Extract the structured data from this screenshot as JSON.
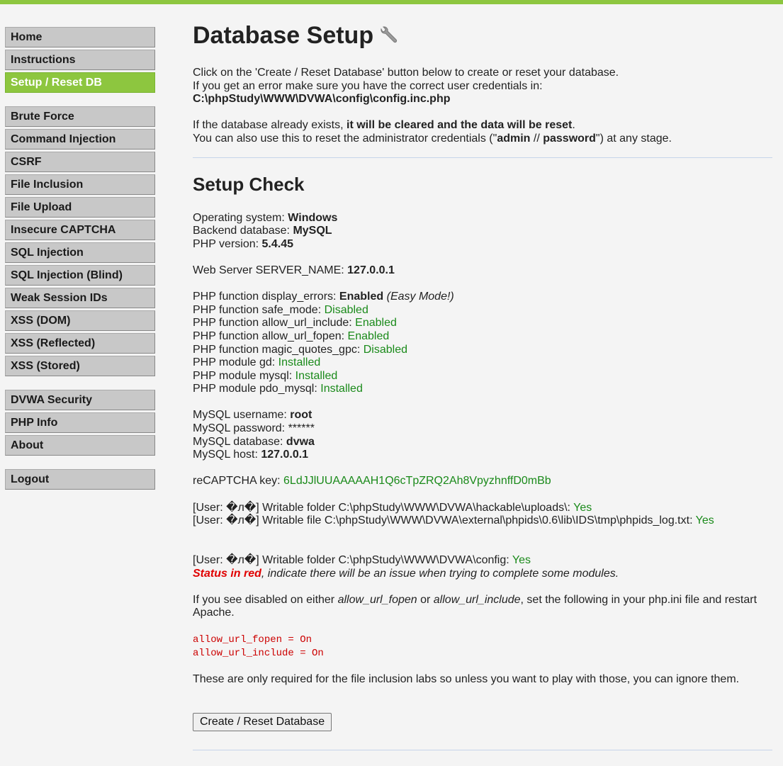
{
  "menu": {
    "group1": [
      "Home",
      "Instructions",
      "Setup / Reset DB"
    ],
    "group2": [
      "Brute Force",
      "Command Injection",
      "CSRF",
      "File Inclusion",
      "File Upload",
      "Insecure CAPTCHA",
      "SQL Injection",
      "SQL Injection (Blind)",
      "Weak Session IDs",
      "XSS (DOM)",
      "XSS (Reflected)",
      "XSS (Stored)"
    ],
    "group3": [
      "DVWA Security",
      "PHP Info",
      "About"
    ],
    "group4": [
      "Logout"
    ],
    "active": "Setup / Reset DB"
  },
  "page": {
    "title": "Database Setup",
    "intro1": "Click on the 'Create / Reset Database' button below to create or reset your database.",
    "intro2": "If you get an error make sure you have the correct user credentials in:",
    "config_path": "C:\\phpStudy\\WWW\\DVWA\\config\\config.inc.php",
    "warn_pre": "If the database already exists, ",
    "warn_bold": "it will be cleared and the data will be reset",
    "warn_post": ".",
    "reset_pre": "You can also use this to reset the administrator credentials (\"",
    "reset_user": "admin",
    "reset_mid": " // ",
    "reset_pass": "password",
    "reset_post": "\") at any stage."
  },
  "check": {
    "title": "Setup Check",
    "os_label": "Operating system: ",
    "os": "Windows",
    "db_label": "Backend database: ",
    "db": "MySQL",
    "php_label": "PHP version: ",
    "php": "5.4.45",
    "server_label": "Web Server SERVER_NAME: ",
    "server": "127.0.0.1",
    "display_errors_label": "PHP function display_errors: ",
    "display_errors": "Enabled",
    "easy_mode": "(Easy Mode!)",
    "safe_mode_label": "PHP function safe_mode: ",
    "safe_mode": "Disabled",
    "url_include_label": "PHP function allow_url_include: ",
    "url_include": "Enabled",
    "url_fopen_label": "PHP function allow_url_fopen: ",
    "url_fopen": "Enabled",
    "magic_label": "PHP function magic_quotes_gpc: ",
    "magic": "Disabled",
    "gd_label": "PHP module gd: ",
    "gd": "Installed",
    "mysql_label": "PHP module mysql: ",
    "mysql": "Installed",
    "pdo_label": "PHP module pdo_mysql: ",
    "pdo": "Installed",
    "user_label": "MySQL username: ",
    "user": "root",
    "pass_label": "MySQL password: ",
    "pass": "******",
    "dbname_label": "MySQL database: ",
    "dbname": "dvwa",
    "host_label": "MySQL host: ",
    "host": "127.0.0.1",
    "recaptcha_label": "reCAPTCHA key: ",
    "recaptcha": "6LdJJlUUAAAAAH1Q6cTpZRQ2Ah8VpyzhnffD0mBb",
    "write1_label": "[User: �л�] Writable folder C:\\phpStudy\\WWW\\DVWA\\hackable\\uploads\\: ",
    "write1": "Yes",
    "write2_label": "[User: �л�] Writable file C:\\phpStudy\\WWW\\DVWA\\external\\phpids\\0.6\\lib\\IDS\\tmp\\phpids_log.txt: ",
    "write2": "Yes",
    "write3_label": "[User: �л�] Writable folder C:\\phpStudy\\WWW\\DVWA\\config: ",
    "write3": "Yes",
    "status_red": "Status in red",
    "status_rest": ", indicate there will be an issue when trying to complete some modules.",
    "disabled_pre": "If you see disabled on either ",
    "disabled_fopen": "allow_url_fopen",
    "disabled_or": " or ",
    "disabled_include": "allow_url_include",
    "disabled_post": ", set the following in your php.ini file and restart Apache.",
    "code1": "allow_url_fopen = On",
    "code2": "allow_url_include = On",
    "labs_note": "These are only required for the file inclusion labs so unless you want to play with those, you can ignore them.",
    "button": "Create / Reset Database"
  }
}
